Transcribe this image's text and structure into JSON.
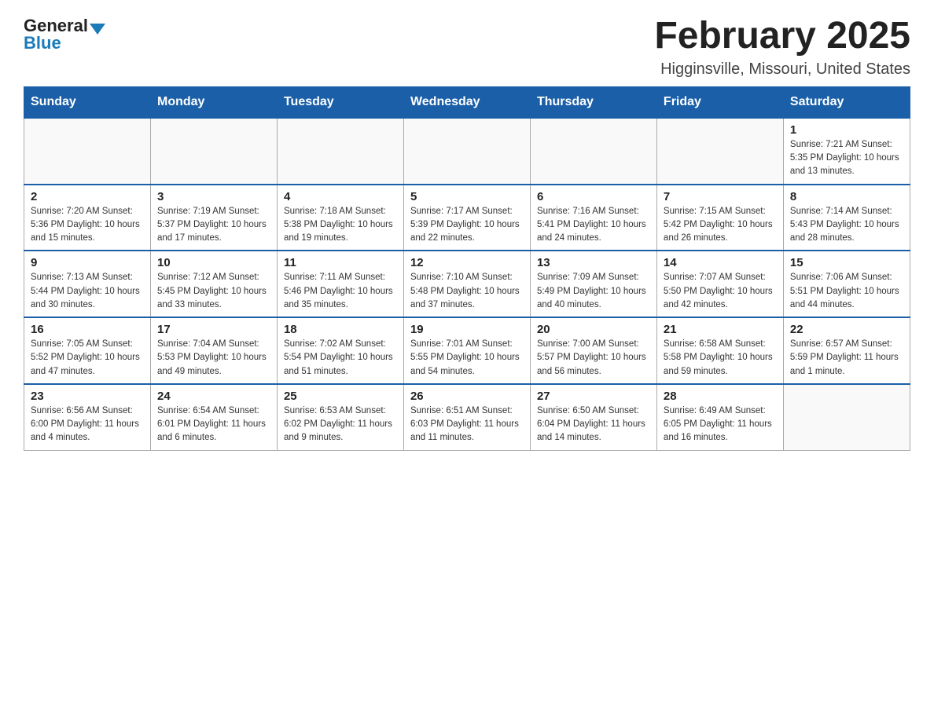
{
  "header": {
    "logo_general": "General",
    "logo_blue": "Blue",
    "month_title": "February 2025",
    "location": "Higginsville, Missouri, United States"
  },
  "days_of_week": [
    "Sunday",
    "Monday",
    "Tuesday",
    "Wednesday",
    "Thursday",
    "Friday",
    "Saturday"
  ],
  "weeks": [
    [
      {
        "day": "",
        "info": ""
      },
      {
        "day": "",
        "info": ""
      },
      {
        "day": "",
        "info": ""
      },
      {
        "day": "",
        "info": ""
      },
      {
        "day": "",
        "info": ""
      },
      {
        "day": "",
        "info": ""
      },
      {
        "day": "1",
        "info": "Sunrise: 7:21 AM\nSunset: 5:35 PM\nDaylight: 10 hours and 13 minutes."
      }
    ],
    [
      {
        "day": "2",
        "info": "Sunrise: 7:20 AM\nSunset: 5:36 PM\nDaylight: 10 hours and 15 minutes."
      },
      {
        "day": "3",
        "info": "Sunrise: 7:19 AM\nSunset: 5:37 PM\nDaylight: 10 hours and 17 minutes."
      },
      {
        "day": "4",
        "info": "Sunrise: 7:18 AM\nSunset: 5:38 PM\nDaylight: 10 hours and 19 minutes."
      },
      {
        "day": "5",
        "info": "Sunrise: 7:17 AM\nSunset: 5:39 PM\nDaylight: 10 hours and 22 minutes."
      },
      {
        "day": "6",
        "info": "Sunrise: 7:16 AM\nSunset: 5:41 PM\nDaylight: 10 hours and 24 minutes."
      },
      {
        "day": "7",
        "info": "Sunrise: 7:15 AM\nSunset: 5:42 PM\nDaylight: 10 hours and 26 minutes."
      },
      {
        "day": "8",
        "info": "Sunrise: 7:14 AM\nSunset: 5:43 PM\nDaylight: 10 hours and 28 minutes."
      }
    ],
    [
      {
        "day": "9",
        "info": "Sunrise: 7:13 AM\nSunset: 5:44 PM\nDaylight: 10 hours and 30 minutes."
      },
      {
        "day": "10",
        "info": "Sunrise: 7:12 AM\nSunset: 5:45 PM\nDaylight: 10 hours and 33 minutes."
      },
      {
        "day": "11",
        "info": "Sunrise: 7:11 AM\nSunset: 5:46 PM\nDaylight: 10 hours and 35 minutes."
      },
      {
        "day": "12",
        "info": "Sunrise: 7:10 AM\nSunset: 5:48 PM\nDaylight: 10 hours and 37 minutes."
      },
      {
        "day": "13",
        "info": "Sunrise: 7:09 AM\nSunset: 5:49 PM\nDaylight: 10 hours and 40 minutes."
      },
      {
        "day": "14",
        "info": "Sunrise: 7:07 AM\nSunset: 5:50 PM\nDaylight: 10 hours and 42 minutes."
      },
      {
        "day": "15",
        "info": "Sunrise: 7:06 AM\nSunset: 5:51 PM\nDaylight: 10 hours and 44 minutes."
      }
    ],
    [
      {
        "day": "16",
        "info": "Sunrise: 7:05 AM\nSunset: 5:52 PM\nDaylight: 10 hours and 47 minutes."
      },
      {
        "day": "17",
        "info": "Sunrise: 7:04 AM\nSunset: 5:53 PM\nDaylight: 10 hours and 49 minutes."
      },
      {
        "day": "18",
        "info": "Sunrise: 7:02 AM\nSunset: 5:54 PM\nDaylight: 10 hours and 51 minutes."
      },
      {
        "day": "19",
        "info": "Sunrise: 7:01 AM\nSunset: 5:55 PM\nDaylight: 10 hours and 54 minutes."
      },
      {
        "day": "20",
        "info": "Sunrise: 7:00 AM\nSunset: 5:57 PM\nDaylight: 10 hours and 56 minutes."
      },
      {
        "day": "21",
        "info": "Sunrise: 6:58 AM\nSunset: 5:58 PM\nDaylight: 10 hours and 59 minutes."
      },
      {
        "day": "22",
        "info": "Sunrise: 6:57 AM\nSunset: 5:59 PM\nDaylight: 11 hours and 1 minute."
      }
    ],
    [
      {
        "day": "23",
        "info": "Sunrise: 6:56 AM\nSunset: 6:00 PM\nDaylight: 11 hours and 4 minutes."
      },
      {
        "day": "24",
        "info": "Sunrise: 6:54 AM\nSunset: 6:01 PM\nDaylight: 11 hours and 6 minutes."
      },
      {
        "day": "25",
        "info": "Sunrise: 6:53 AM\nSunset: 6:02 PM\nDaylight: 11 hours and 9 minutes."
      },
      {
        "day": "26",
        "info": "Sunrise: 6:51 AM\nSunset: 6:03 PM\nDaylight: 11 hours and 11 minutes."
      },
      {
        "day": "27",
        "info": "Sunrise: 6:50 AM\nSunset: 6:04 PM\nDaylight: 11 hours and 14 minutes."
      },
      {
        "day": "28",
        "info": "Sunrise: 6:49 AM\nSunset: 6:05 PM\nDaylight: 11 hours and 16 minutes."
      },
      {
        "day": "",
        "info": ""
      }
    ]
  ]
}
